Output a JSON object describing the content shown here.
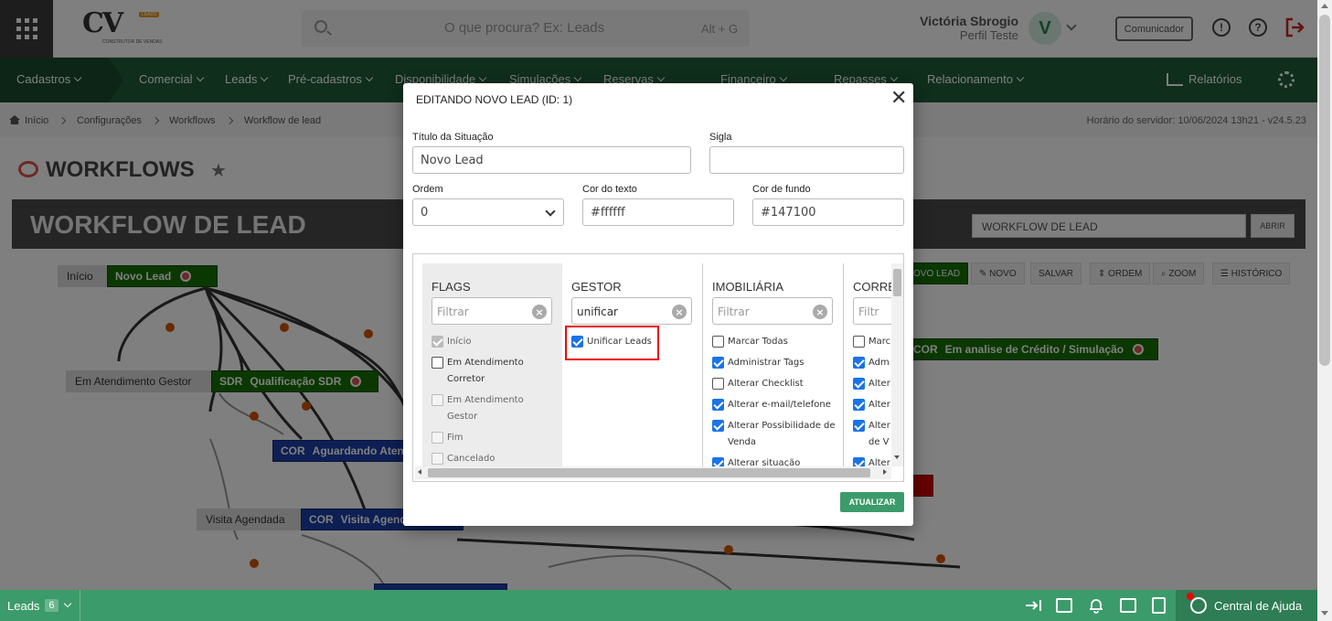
{
  "topbar": {
    "logo_text": "CV",
    "logo_badge": "LEADS",
    "logo_sub": "CONSTRUTOR DE VENDAS",
    "search_placeholder": "O que procura? Ex: Leads",
    "search_shortcut": "Alt + G",
    "user_name": "Victória Sbrogio",
    "user_profile": "Perfil Teste",
    "avatar_letter": "V",
    "comunicador_label": "Comunicador"
  },
  "nav": {
    "items": [
      "Cadastros",
      "Comercial",
      "Leads",
      "Pré-cadastros",
      "Disponibilidade",
      "Simulações",
      "Reservas",
      "Financeiro",
      "Repasses",
      "Relacionamento"
    ],
    "relatorios": "Relatórios"
  },
  "breadcrumb": {
    "items": [
      "Início",
      "Configurações",
      "Workflows",
      "Workflow de lead"
    ],
    "server_time": "Horário do servidor: 10/06/2024 13h21 - v24.5.23"
  },
  "page": {
    "title": "WORKFLOWS",
    "workflow_title": "WORKFLOW DE LEAD",
    "workflow_select": "WORKFLOW DE LEAD",
    "abrir": "ABRIR",
    "toolbar": [
      "OVO LEAD",
      "✎ NOVO",
      "SALVAR",
      "⇕ ORDEM",
      "⌕ ZOOM",
      "☰ HISTÓRICO"
    ],
    "nodes": {
      "inicio_label": "Início",
      "novo_lead": "Novo Lead",
      "atendimento_label": "Em Atendimento Gestor",
      "sdr_tag": "SDR",
      "sdr_name": "Qualificação SDR",
      "cor_tag": "COR",
      "aguardando": "Aguardando Atendimento",
      "visita_label": "Visita Agendada",
      "visita": "Visita Agendada",
      "credito": "Em analise de Crédito / Simulação"
    }
  },
  "modal": {
    "title": "EDITANDO NOVO LEAD (ID: 1)",
    "close": "✕",
    "titulo_label": "Título da Situação",
    "titulo_value": "Novo Lead",
    "sigla_label": "Sigla",
    "sigla_value": "",
    "ordem_label": "Ordem",
    "ordem_value": "0",
    "cor_texto_label": "Cor do texto",
    "cor_texto_value": "#ffffff",
    "cor_fundo_label": "Cor de fundo",
    "cor_fundo_value": "#147100",
    "atualizar": "ATUALIZAR",
    "columns": {
      "flags": {
        "title": "FLAGS",
        "filter_placeholder": "Filtrar",
        "items": [
          {
            "label": "Início",
            "checked": true,
            "disabled": true
          },
          {
            "label": "Em Atendimento Corretor",
            "checked": false,
            "disabled": false
          },
          {
            "label": "Em Atendimento Gestor",
            "checked": false,
            "disabled": true
          },
          {
            "label": "Fim",
            "checked": false,
            "disabled": true
          },
          {
            "label": "Cancelado",
            "checked": false,
            "disabled": true
          }
        ]
      },
      "gestor": {
        "title": "GESTOR",
        "filter_value": "unificar",
        "items": [
          {
            "label": "Unificar Leads",
            "checked": true
          }
        ]
      },
      "imobiliaria": {
        "title": "IMOBILIÁRIA",
        "filter_placeholder": "Filtrar",
        "items": [
          {
            "label": "Marcar Todas",
            "checked": false
          },
          {
            "label": "Administrar Tags",
            "checked": true
          },
          {
            "label": "Alterar Checklist",
            "checked": false
          },
          {
            "label": "Alterar e-mail/telefone",
            "checked": true
          },
          {
            "label": "Alterar Possibilidade de Venda",
            "checked": true
          },
          {
            "label": "Alterar situação",
            "checked": true
          }
        ]
      },
      "corretor": {
        "title": "CORRE",
        "filter_placeholder": "Filtr",
        "items": [
          {
            "label": "Marc",
            "checked": false
          },
          {
            "label": "Adm",
            "checked": true
          },
          {
            "label": "Alter",
            "checked": true
          },
          {
            "label": "Alter",
            "checked": true
          },
          {
            "label": "Alter de V",
            "checked": true
          },
          {
            "label": "Alter",
            "checked": true
          }
        ]
      }
    }
  },
  "bottombar": {
    "leads_label": "Leads",
    "leads_count": "6",
    "help": "Central de Ajuda"
  },
  "colors": {
    "brand_green": "#1f5c39",
    "action_green": "#3c9b6a",
    "node_green": "#147100",
    "node_blue": "#1a3ea8",
    "highlight": "#ee0000"
  }
}
